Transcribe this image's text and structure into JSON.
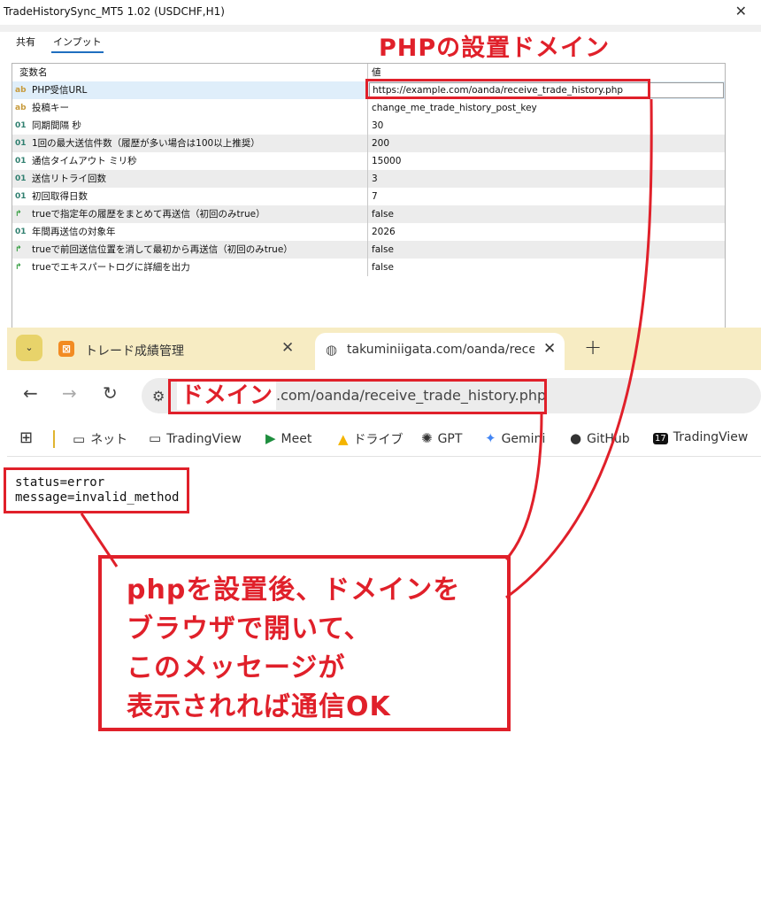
{
  "window": {
    "title": "TradeHistorySync_MT5 1.02 (USDCHF,H1)",
    "close": "✕"
  },
  "tabs": [
    {
      "label": "共有"
    },
    {
      "label": "インプット"
    }
  ],
  "annotation_title": "PHPの設置ドメイン",
  "grid": {
    "header": {
      "name": "変数名",
      "value": "値"
    },
    "rows": [
      {
        "icon": "ab",
        "name": "PHP受信URL",
        "value": "https://example.com/oanda/receive_trade_history.php"
      },
      {
        "icon": "ab",
        "name": "投稿キー",
        "value": "change_me_trade_history_post_key"
      },
      {
        "icon": "01",
        "name": "同期間隔 秒",
        "value": "30"
      },
      {
        "icon": "01",
        "name": "1回の最大送信件数（履歴が多い場合は100以上推奨）",
        "value": "200"
      },
      {
        "icon": "01",
        "name": "通信タイムアウト ミリ秒",
        "value": "15000"
      },
      {
        "icon": "01",
        "name": "送信リトライ回数",
        "value": "3"
      },
      {
        "icon": "01",
        "name": "初回取得日数",
        "value": "7"
      },
      {
        "icon": "bool-arrow-icon",
        "name": "trueで指定年の履歴をまとめて再送信（初回のみtrue）",
        "value": "false"
      },
      {
        "icon": "01",
        "name": "年間再送信の対象年",
        "value": "2026"
      },
      {
        "icon": "bool-arrow-icon",
        "name": "trueで前回送信位置を消して最初から再送信（初回のみtrue）",
        "value": "false"
      },
      {
        "icon": "bool-arrow-icon",
        "name": "trueでエキスパートログに詳細を出力",
        "value": "false"
      }
    ]
  },
  "browser": {
    "tabs": [
      {
        "title": "トレード成績管理",
        "favicon": "xampp-icon",
        "active": false
      },
      {
        "title": "takuminiigata.com/oanda/receive_trade_history.php",
        "favicon": "globe-icon",
        "active": true
      }
    ],
    "address": {
      "domain_label": "ドメイン",
      "path": ".com/oanda/receive_trade_history.php"
    },
    "bookmarks": [
      {
        "label": "ネット",
        "icon": "folder-icon"
      },
      {
        "label": "TradingView",
        "icon": "folder-icon"
      },
      {
        "label": "Meet",
        "icon": "meet-icon"
      },
      {
        "label": "ドライブ",
        "icon": "drive-icon"
      },
      {
        "label": "GPT",
        "icon": "openai-icon"
      },
      {
        "label": "Gemini",
        "icon": "gemini-icon"
      },
      {
        "label": "GitHub",
        "icon": "github-icon"
      },
      {
        "label": "TradingView",
        "icon": "tradingview-icon"
      }
    ]
  },
  "response": {
    "line1": "status=error",
    "line2": "message=invalid_method"
  },
  "note": {
    "lines": [
      "phpを設置後、ドメインを",
      "ブラウザで開いて、",
      "このメッセージが",
      "表示されれば通信OK"
    ]
  },
  "colors": {
    "annotation_red": "#e0202a",
    "chrome_tabbar": "#f7ecc3",
    "selected_row": "#dfeefa",
    "alt_row": "#ececec"
  }
}
